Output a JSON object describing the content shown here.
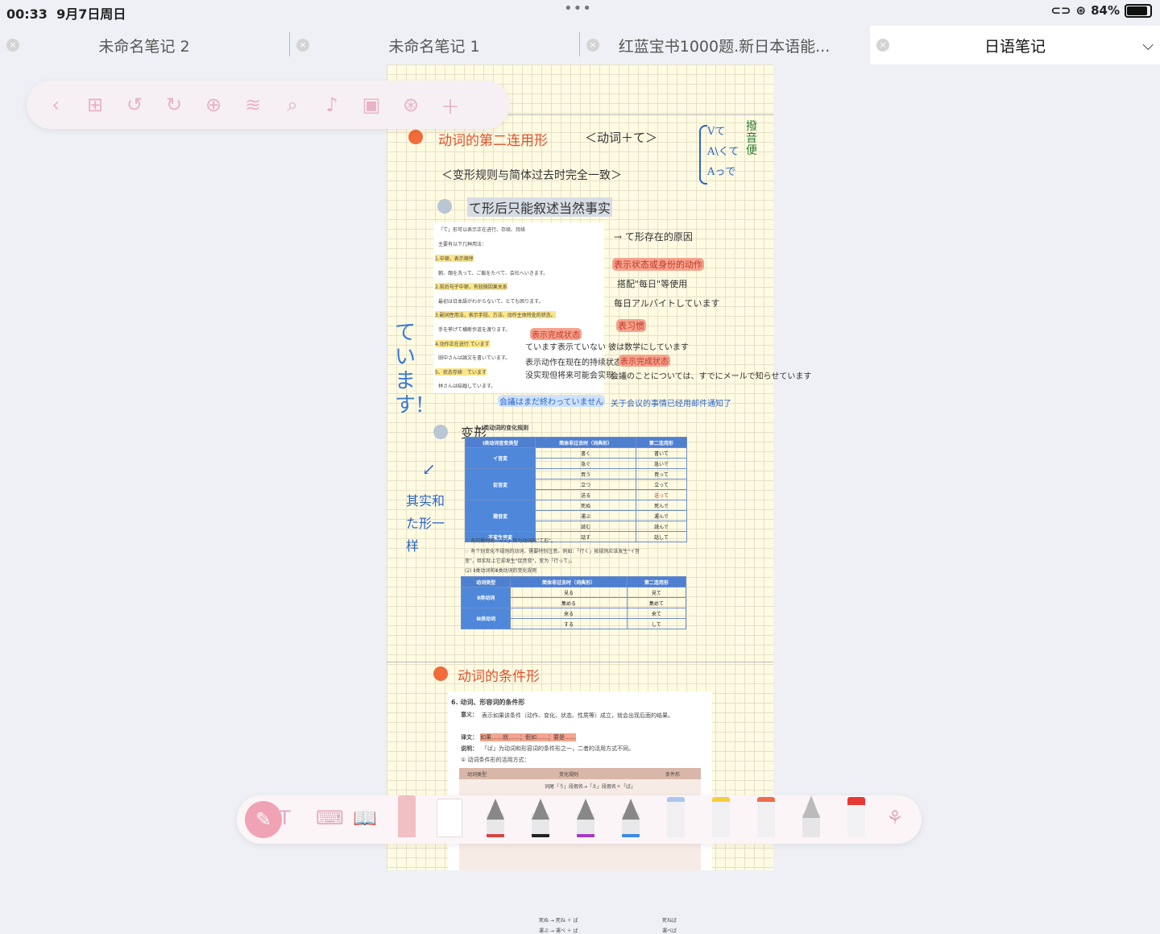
{
  "status_bar": {
    "time": "00:33",
    "date": "9月7日周日",
    "battery": "84%"
  },
  "tabs": [
    {
      "label": "未命名笔记 2"
    },
    {
      "label": "未命名笔记 1"
    },
    {
      "label": "红蓝宝书1000题.新日本语能..."
    },
    {
      "label": "日语笔记"
    }
  ],
  "handwritten": {
    "heading1": "动词的第二连用形",
    "heading1_tag": "＜动词＋て＞",
    "side_conj": [
      "Vて",
      "A\\くて",
      "Aっで"
    ],
    "side_note": "撥音便",
    "subtitle1": "＜变形规则与简体过去时完全一致＞",
    "point1": "て形后只能叙述当然事实",
    "arrow_note": "→ て形存在的原因",
    "label_state": "表示状态或身份的动作",
    "ex_state_note": "搭配\"每日\"等使用",
    "ex_state": "每日アルバイトしています",
    "label_yet": "表习惯",
    "yet_line1": "ています表示ていない 彼は数学にしています",
    "yet_line2": "表示动作在现在的持续状态",
    "yet_line3": "没实现但将来可能会实现。",
    "label_done": "表示完成状态",
    "done_ex": "会議のことについては、すでにメールで知らせています",
    "done_note": "关于会议的事情已经用邮件通知了",
    "blue_ex": "会議はまだ終わっていません",
    "vertical": "ています!",
    "henkei": "变形",
    "left_note": "其实和た形一样",
    "heading2": "动词的条件形"
  },
  "card1": {
    "lines": [
      "「て」形可以表示正在进行、存续、持续",
      "主要有以下几种用法：",
      "1.中顿，表示顺序",
      "朝、顔を洗って、ご飯をたべて、会社へいきます。",
      "2.前后句子中顿，有轻微因果关系",
      "最初は日本語がわからないて、とても困ります。",
      "3.副词性用法，表示手段、方法、动作主体所处的状态。",
      "手を挙げて横断歩道を渡ります。",
      "4.动作正在进行 ています",
      "田中さんは論文を書いています。",
      "5、状态存续　ています",
      "林さんは結婚しています。"
    ]
  },
  "table1": {
    "title": "1.I类动词的变化规则",
    "headers": [
      "I类动词音变类型",
      "简体非过去时（词典形）",
      "第二连用形"
    ],
    "groups": [
      "イ音変",
      "促音変",
      "撥音変",
      "不変生音変"
    ],
    "rows": [
      [
        "書く",
        "書いて"
      ],
      [
        "急ぐ",
        "急いで"
      ],
      [
        "買う",
        "買って"
      ],
      [
        "立つ",
        "立って"
      ],
      [
        "送る",
        "送って"
      ],
      [
        "死ぬ",
        "死んで"
      ],
      [
        "運ぶ",
        "運んで"
      ],
      [
        "読む",
        "読んで"
      ],
      [
        "話す",
        "話して"
      ]
    ],
    "notes": [
      "☞ 有的教材将「Vて」称为动词的\"て形\"。",
      "☞ 有个别变化不规则的动词，需要特别注意。例如：「行く」按规则应该发生\"イ音",
      "变\"，但实际上它却发生\"促音变\"，变为「行って」。",
      "(2) Ⅱ类动词和Ⅲ类动词的变化规则"
    ]
  },
  "table2": {
    "headers": [
      "动词类型",
      "简体非过去时（词典形）",
      "第二连用形"
    ],
    "rows": [
      [
        "Ⅱ类动词",
        "見る",
        "見て"
      ],
      [
        "",
        "集める",
        "集めて"
      ],
      [
        "Ⅲ类动词",
        "来る",
        "来て"
      ],
      [
        "",
        "する",
        "して"
      ]
    ]
  },
  "card2": {
    "title": "6. 动词、形容词的条件形",
    "meaning_label": "意义：",
    "meaning": "表示如果该条件（动作、变化、状态、性质等）成立，就会出现后面的结果。",
    "trans_label": "译文：",
    "trans": "如果……就……；假如……；要是……",
    "explain_label": "说明：",
    "explain": "「ば」为动词和形容词的条件形之一，二者的活用方式不同。",
    "sub": "① 动词条件形的活用方式：",
    "headers": [
      "动词类型",
      "变化规则",
      "条件形"
    ],
    "rule": "词尾「う」段假名→「え」段假名＋「ば」",
    "rows": [
      [
        "死ぬ → 死ね ＋ ば",
        "死ねば"
      ],
      [
        "運ぶ → 運べ ＋ ば",
        "運べば"
      ]
    ]
  },
  "colors": {
    "accent_pink": "#f0a3b4",
    "heading_red": "#e2522b",
    "note_blue": "#3a7bd5",
    "page_yellow": "#fffbe3"
  },
  "icons": {
    "toolbar_top": [
      "back-icon",
      "grid-icon",
      "undo-icon",
      "redo-icon",
      "new-page-icon",
      "layers-icon",
      "search-icon",
      "mic-icon",
      "camera-icon",
      "globe-icon",
      "add-icon"
    ],
    "toolbar_bottom": [
      "pen-icon",
      "text-icon",
      "keyboard-icon",
      "book-icon",
      "eraser-icon",
      "ruler-icon",
      "fountain-pen-red-icon",
      "fountain-pen-black-icon",
      "fountain-pen-purple-icon",
      "fountain-pen-blue-icon",
      "highlighter-blue-icon",
      "highlighter-yellow-icon",
      "highlighter-red-icon",
      "pencil-icon",
      "brush-red-icon",
      "palette-icon"
    ]
  }
}
